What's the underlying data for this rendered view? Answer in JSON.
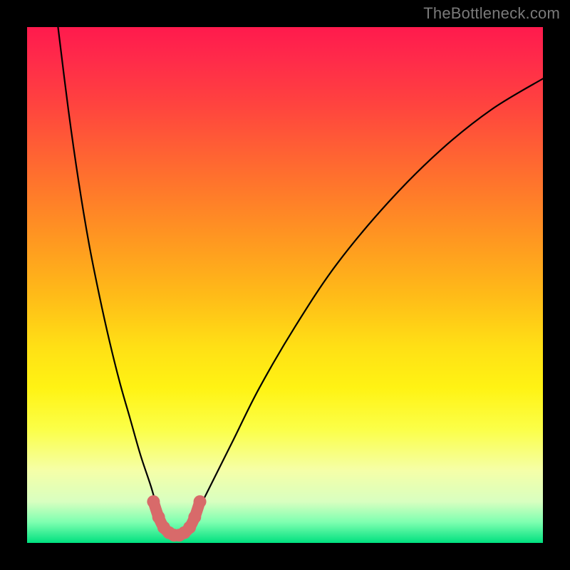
{
  "watermark": "TheBottleneck.com",
  "chart_data": {
    "type": "line",
    "title": "",
    "xlabel": "",
    "ylabel": "",
    "xlim": [
      0,
      100
    ],
    "ylim": [
      0,
      100
    ],
    "series": [
      {
        "name": "bottleneck-curve",
        "x": [
          6,
          8,
          10,
          12,
          14,
          16,
          18,
          20,
          22,
          24,
          25.5,
          27,
          28.5,
          30,
          31.5,
          33,
          36,
          40,
          45,
          52,
          60,
          70,
          80,
          90,
          100
        ],
        "y": [
          100,
          84,
          70,
          58,
          48,
          39,
          31,
          24,
          17,
          11,
          6,
          3,
          1.5,
          1.5,
          3,
          6,
          12,
          20,
          30,
          42,
          54,
          66,
          76,
          84,
          90
        ]
      },
      {
        "name": "valley-highlight",
        "x": [
          24.5,
          25.5,
          26.5,
          27.5,
          28.5,
          29.5,
          30.5,
          31.5,
          32.5,
          33.5
        ],
        "y": [
          8,
          5,
          3,
          2,
          1.5,
          1.5,
          2,
          3,
          5,
          8
        ]
      }
    ],
    "colors": {
      "curve": "#000000",
      "highlight": "#d86a6a",
      "gradient_top": "#ff1a4d",
      "gradient_bottom": "#00e07f"
    }
  }
}
